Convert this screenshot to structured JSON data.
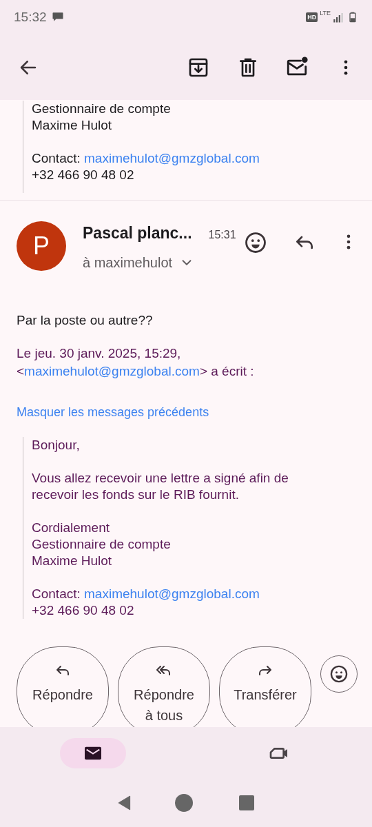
{
  "status_bar": {
    "time": "15:32",
    "indicators": [
      "HD",
      "LTE"
    ]
  },
  "previous_message": {
    "lines": [
      "Gestionnaire de compte",
      "Maxime Hulot"
    ],
    "contact_label": "Contact:",
    "contact_email": "maximehulot@gmzglobal.com",
    "phone": "+32 466 90 48 02"
  },
  "message": {
    "avatar_letter": "P",
    "sender": "Pascal planc...",
    "time": "15:31",
    "recipient": "à maximehulot",
    "body": "Par la poste ou autre??",
    "quote_header": {
      "date_line": "Le jeu. 30 janv. 2025, 15:29,",
      "email_prefix": "<",
      "email": "maximehulot@gmzglobal.com",
      "email_suffix": "> a écrit :"
    },
    "hide_quoted_link": "Masquer les messages précédents",
    "quoted": {
      "paragraphs": [
        [
          "Bonjour,"
        ],
        [
          "Vous allez recevoir une lettre a signé afin de recevoir les fonds sur le RIB fournit."
        ],
        [
          "Cordialement",
          "Gestionnaire de compte",
          "Maxime Hulot"
        ]
      ],
      "contact_label": "Contact:",
      "contact_email": "maximehulot@gmzglobal.com",
      "phone": "+32 466 90 48 02"
    }
  },
  "actions": [
    {
      "kind": "reply",
      "label": "Répondre"
    },
    {
      "kind": "reply_all",
      "label": "Répondre à tous"
    },
    {
      "kind": "forward",
      "label": "Transférer"
    }
  ],
  "bottom_nav": [
    {
      "kind": "mail",
      "selected": true
    },
    {
      "kind": "video",
      "selected": false
    }
  ]
}
